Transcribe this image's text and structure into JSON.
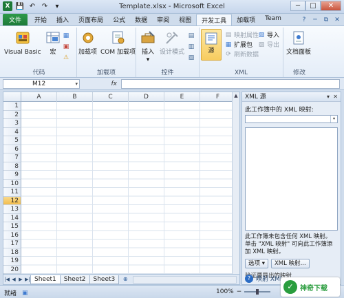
{
  "window": {
    "title": "Template.xlsx - Microsoft Excel",
    "min_glyph": "─",
    "max_glyph": "□",
    "close_glyph": "✕"
  },
  "qat": {
    "app_icon": "X",
    "save_icon": "💾",
    "undo_icon": "↶",
    "redo_icon": "↷",
    "more_icon": "▾"
  },
  "tabs": [
    {
      "label": "文件"
    },
    {
      "label": "开始"
    },
    {
      "label": "插入"
    },
    {
      "label": "页面布局"
    },
    {
      "label": "公式"
    },
    {
      "label": "数据"
    },
    {
      "label": "审阅"
    },
    {
      "label": "视图"
    },
    {
      "label": "开发工具"
    },
    {
      "label": "加载项"
    },
    {
      "label": "Team"
    }
  ],
  "tabs_right": {
    "help": "?",
    "min": "─",
    "restore": "⧉",
    "close": "✕"
  },
  "ribbon": {
    "code": {
      "label": "代码",
      "visual_basic": "Visual Basic",
      "macro": "宏",
      "record_icon": "▦",
      "relative_icon": "▣",
      "security_icon": "⚠"
    },
    "addins": {
      "label": "加载项",
      "addins_btn": "加载项",
      "com_addins_btn": "COM 加载项"
    },
    "controls": {
      "label": "控件",
      "insert": "插入",
      "insert_arrow": "▾",
      "design_mode": "设计模式",
      "properties_icon": "▤",
      "view_code_icon": "▥",
      "run_dialog_icon": "▧"
    },
    "xml": {
      "label": "XML",
      "source": "源",
      "map_properties": "映射属性",
      "expansion_packs": "扩展包",
      "refresh_data": "刷新数据",
      "import": "导入",
      "export": "导出"
    },
    "modify": {
      "label": "修改",
      "document_panel": "文档面板"
    }
  },
  "formula_bar": {
    "name_box": "M12",
    "name_box_arrow": "▾",
    "fx": "fx",
    "formula": ""
  },
  "grid": {
    "columns": [
      "A",
      "B",
      "C",
      "D",
      "E",
      "F"
    ],
    "rows": [
      "1",
      "2",
      "3",
      "4",
      "5",
      "6",
      "7",
      "8",
      "9",
      "10",
      "11",
      "12",
      "13",
      "14",
      "15",
      "16",
      "17",
      "18",
      "19",
      "20"
    ],
    "selected_row": "12",
    "scroll_up": "▲",
    "scroll_down": "▼"
  },
  "sheet_tabs": {
    "nav": [
      "|◀",
      "◀",
      "▶",
      "▶|"
    ],
    "sheets": [
      "Sheet1",
      "Sheet2",
      "Sheet3"
    ],
    "active": "Sheet1",
    "add_icon": "⊕"
  },
  "xml_pane": {
    "title": "XML 源",
    "dropdown_glyph": "▾",
    "close_glyph": "✕",
    "maps_label": "此工作簿中的 XML 映射:",
    "select_arrow": "▾",
    "message_line1": "此工作簿未包含任何 XML 映射。",
    "message_line2": "单击 \"XML 映射\" 可向此工作簿添",
    "message_line3": "加 XML 映射。",
    "options_btn": "选项 ▾",
    "xml_maps_btn": "XML 映射...",
    "verify_text": "验证要导出的映射",
    "help_icon": "?",
    "help_text": "映射 XML"
  },
  "status": {
    "ready": "就绪",
    "zoom": "100%",
    "zoom_minus": "−",
    "zoom_plus": "+"
  },
  "watermark": {
    "logo_text": "✓",
    "text": "神奇下载"
  },
  "colors": {
    "file_tab": "#1e7a38",
    "selected_row": "#f3bd4d",
    "accent": "#2b6cc4"
  }
}
